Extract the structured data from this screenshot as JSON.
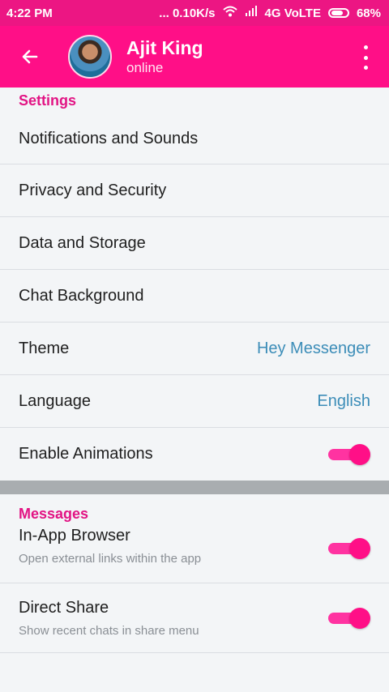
{
  "status_bar": {
    "time": "4:22 PM",
    "network_speed": "... 0.10K/s",
    "network_type": "4G VoLTE",
    "battery": "68%"
  },
  "header": {
    "contact_name": "Ajit King",
    "presence": "online"
  },
  "settings": {
    "title": "Settings",
    "items": [
      {
        "label": "Notifications and Sounds"
      },
      {
        "label": "Privacy and Security"
      },
      {
        "label": "Data and Storage"
      },
      {
        "label": "Chat Background"
      },
      {
        "label": "Theme",
        "value": "Hey Messenger"
      },
      {
        "label": "Language",
        "value": "English"
      },
      {
        "label": "Enable Animations",
        "toggle": true
      }
    ]
  },
  "messages": {
    "title": "Messages",
    "items": [
      {
        "label": "In-App Browser",
        "description": "Open external links within the app",
        "toggle": true
      },
      {
        "label": "Direct Share",
        "description": "Show recent chats in share menu",
        "toggle": true
      }
    ]
  },
  "colors": {
    "accent": "#ff0f87",
    "status_bar": "#ec1683",
    "link_value": "#3c8db8"
  }
}
